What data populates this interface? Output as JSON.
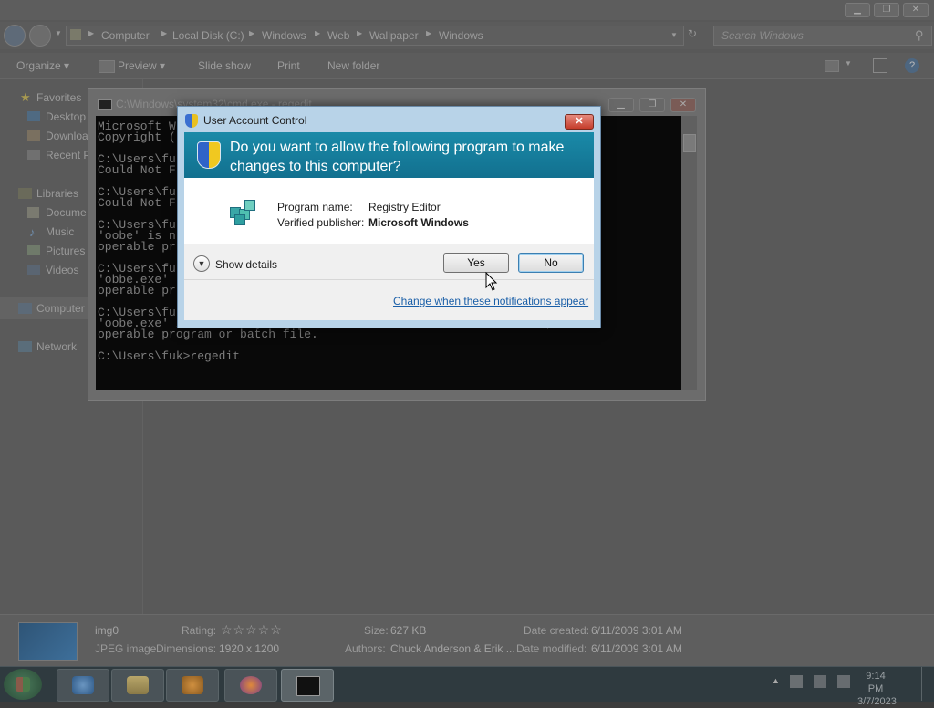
{
  "explorer": {
    "breadcrumb": [
      "Computer",
      "Local Disk (C:)",
      "Windows",
      "Web",
      "Wallpaper",
      "Windows"
    ],
    "search_placeholder": "Search Windows",
    "toolbar": {
      "organize": "Organize ▾",
      "preview": "Preview ▾",
      "slideshow": "Slide show",
      "print": "Print",
      "new_folder": "New folder"
    },
    "nav": {
      "favorites": "Favorites",
      "desktop": "Desktop",
      "downloads": "Downloa",
      "recent": "Recent P",
      "libraries": "Libraries",
      "documents": "Docume",
      "music": "Music",
      "pictures": "Pictures",
      "videos": "Videos",
      "computer": "Computer",
      "network": "Network"
    },
    "details": {
      "name": "img0",
      "type": "JPEG image",
      "dimensions_label": "Dimensions:",
      "dimensions": "1920 x 1200",
      "rating_label": "Rating:",
      "rating": "☆☆☆☆☆",
      "size_label": "Size:",
      "size": "627 KB",
      "authors_label": "Authors:",
      "authors": "Chuck Anderson & Erik ...",
      "created_label": "Date created:",
      "created": "6/11/2009 3:01 AM",
      "modified_label": "Date modified:",
      "modified": "6/11/2009 3:01 AM"
    }
  },
  "cmd": {
    "title": "C:\\Windows\\system32\\cmd.exe - regedit",
    "lines": [
      "Microsoft W",
      "Copyright (",
      "",
      "C:\\Users\\fu",
      "Could Not F",
      "",
      "C:\\Users\\fu",
      "Could Not F",
      "",
      "C:\\Users\\fu",
      "'oobe' is n",
      "operable pr",
      "",
      "C:\\Users\\fu",
      "'obbe.exe'",
      "operable pr",
      "",
      "C:\\Users\\fuk>oobe.exe",
      "'oobe.exe' is not recognized as an internal or external command,",
      "operable program or batch file.",
      "",
      "C:\\Users\\fuk>regedit"
    ]
  },
  "uac": {
    "title": "User Account Control",
    "close": "✕",
    "question": "Do you want to allow the following program to make changes to this computer?",
    "program_label": "Program name:",
    "program_value": "Registry Editor",
    "publisher_label": "Verified publisher:",
    "publisher_value": "Microsoft Windows",
    "show_details": "Show details",
    "yes": "Yes",
    "no": "No",
    "change_link": "Change when these notifications appear"
  },
  "taskbar": {
    "time": "9:14 PM",
    "date": "3/7/2023"
  }
}
